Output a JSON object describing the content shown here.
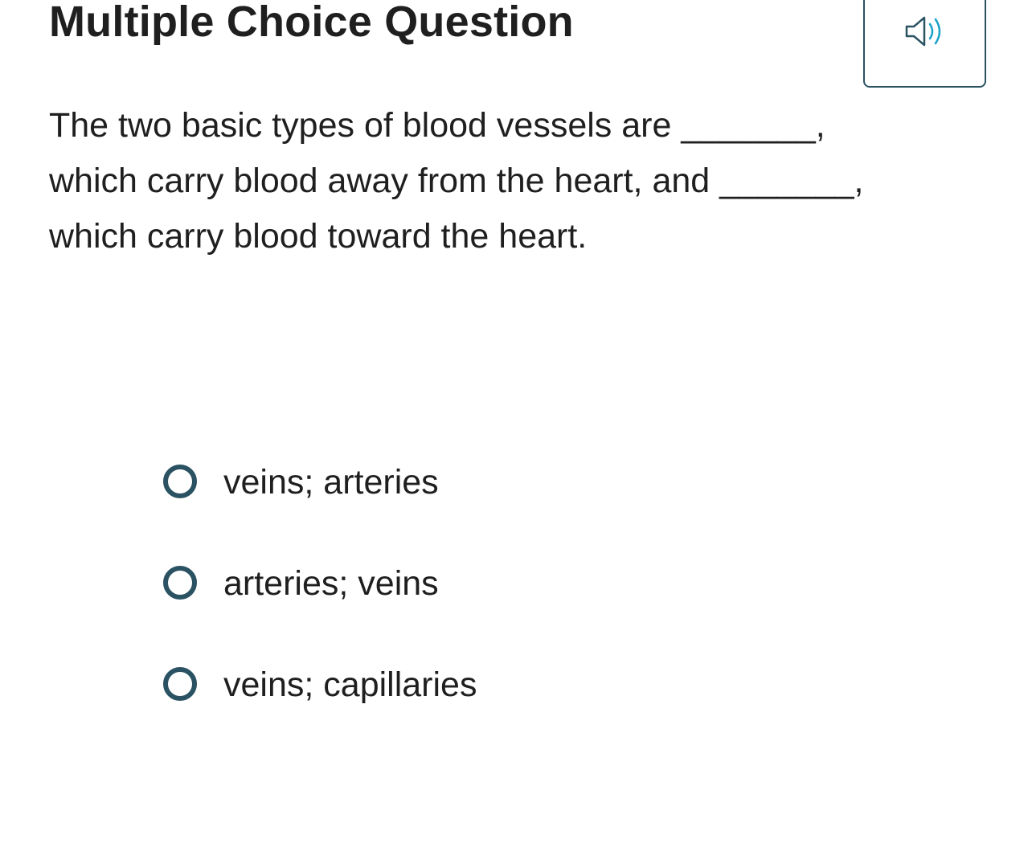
{
  "question": {
    "heading": "Multiple Choice Question",
    "audio_icon": "speaker-volume-icon",
    "prompt_lines": [
      "The two basic types of blood vessels are _______,",
      "which carry blood away from the heart, and _______,",
      "which carry blood toward the heart."
    ]
  },
  "choices": [
    {
      "label": "veins; arteries"
    },
    {
      "label": "arteries; veins"
    },
    {
      "label": "veins; capillaries"
    }
  ],
  "colors": {
    "text": "#1f1f1f",
    "accent": "#2a5262",
    "speaker_waves": "#1aa3c9"
  }
}
